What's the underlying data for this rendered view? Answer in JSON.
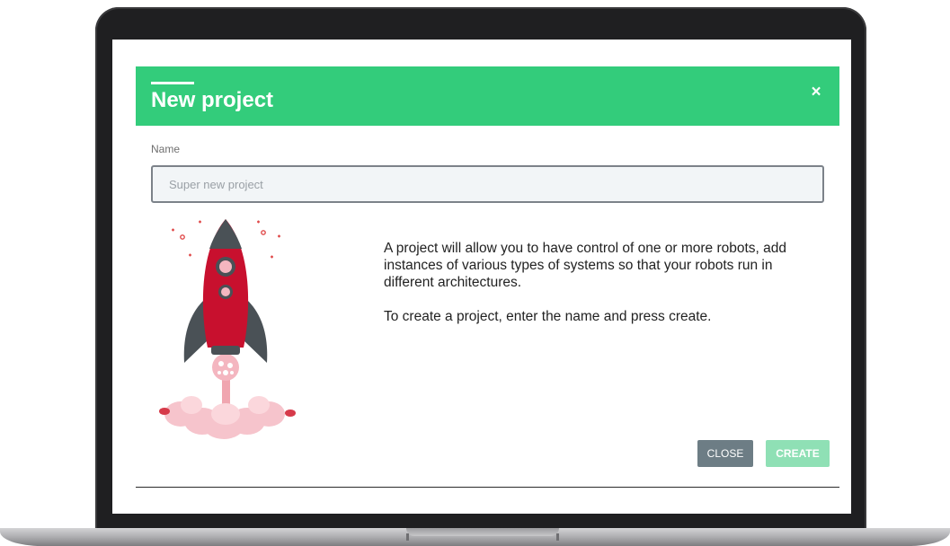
{
  "dialog": {
    "title": "New project",
    "name_label": "Name",
    "name_placeholder": "Super new project",
    "description": [
      "A project will allow you to have control of one or more robots, add instances of various types of systems so that your robots run in different architectures.",
      "To create a project, enter the name and press create."
    ],
    "close_label": "CLOSE",
    "create_label": "CREATE",
    "close_icon": "×"
  },
  "colors": {
    "header": "#33cc7b",
    "close_button": "#6d7d85",
    "create_button": "#8fe0b5",
    "rocket_body": "#c8102e",
    "rocket_fins": "#4a5156"
  },
  "icons": [
    "close-icon",
    "rocket-illustration"
  ]
}
